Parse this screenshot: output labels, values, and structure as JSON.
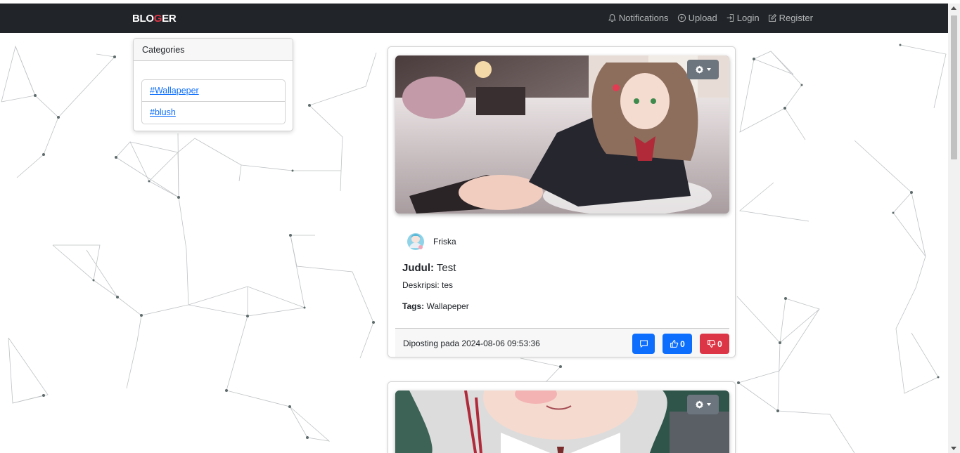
{
  "navbar": {
    "brand_start": "BLO",
    "brand_accent": "G",
    "brand_end": "ER",
    "links": [
      {
        "label": "Notifications",
        "icon": "bell-icon"
      },
      {
        "label": "Upload",
        "icon": "plus-circle-icon"
      },
      {
        "label": "Login",
        "icon": "login-icon"
      },
      {
        "label": "Register",
        "icon": "pencil-square-icon"
      }
    ]
  },
  "categories": {
    "title": "Categories",
    "items": [
      "#Wallapeper",
      "#blush"
    ]
  },
  "posts": [
    {
      "author": "Friska",
      "title_label": "Judul:",
      "title": "Test",
      "description_label": "Deskripsi:",
      "description": "tes",
      "tags_label": "Tags:",
      "tags": "Wallapeper",
      "posted_label": "Diposting pada",
      "posted_at": "2024-08-06 09:53:36",
      "likes": "0",
      "dislikes": "0"
    }
  ],
  "colors": {
    "navbar": "#212529",
    "brand_accent": "#dc3545",
    "primary": "#0d6efd",
    "danger": "#dc3545",
    "secondary": "#6c757d"
  }
}
